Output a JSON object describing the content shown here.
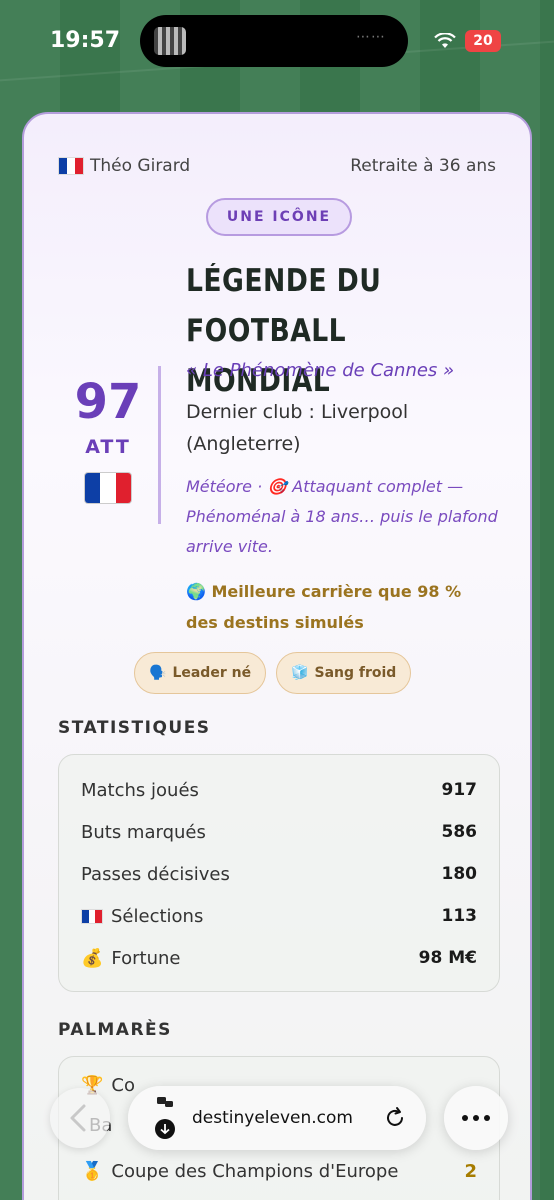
{
  "status": {
    "time": "19:57",
    "battery": "20"
  },
  "card": {
    "player_name": "Théo Girard",
    "retired": "Retraite à 36 ans",
    "badge": "UNE ICÔNE",
    "title": "LÉGENDE DU FOOTBALL MONDIAL",
    "nickname": "« Le Phénomène de Cannes »",
    "last_club": "Dernier club : Liverpool (Angleterre)",
    "description": "Météore · 🎯 Attaquant complet — Phénoménal à 18 ans… puis le plafond arrive vite.",
    "career": "🌍 Meilleure carrière que 98 % des destins simulés",
    "rating": "97",
    "position": "ATT",
    "traits": [
      {
        "icon": "🗣️",
        "label": "Leader né"
      },
      {
        "icon": "🧊",
        "label": "Sang froid"
      }
    ]
  },
  "stats": {
    "title": "STATISTIQUES",
    "rows": [
      {
        "icon": "",
        "label": "Matchs joués",
        "value": "917"
      },
      {
        "icon": "",
        "label": "Buts marqués",
        "value": "586"
      },
      {
        "icon": "",
        "label": "Passes décisives",
        "value": "180"
      },
      {
        "icon": "flag-fr",
        "label": "Sélections",
        "value": "113"
      },
      {
        "icon": "💰",
        "label": "Fortune",
        "value": "98 M€"
      }
    ]
  },
  "palmares": {
    "title": "PALMARÈS",
    "rows": [
      {
        "icon": "🏆",
        "label": "Co",
        "value": ""
      },
      {
        "icon": "",
        "label": "Ba",
        "value": ""
      },
      {
        "icon": "🥇",
        "label": "Coupe des Champions d'Europe",
        "value": "2"
      }
    ]
  },
  "browser": {
    "url": "destinyeleven.com"
  },
  "colors": {
    "accent": "#6a3fb8",
    "gold": "#9b7420",
    "background": "#3c7a50"
  }
}
